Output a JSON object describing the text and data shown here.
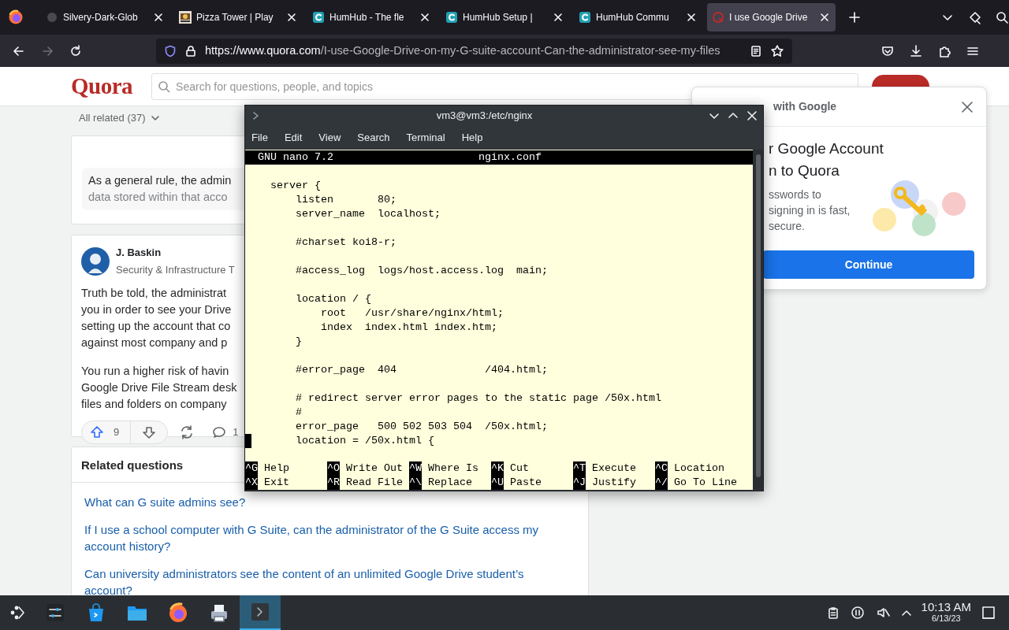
{
  "browser": {
    "tabs": [
      {
        "title": "Silvery-Dark-Glob",
        "kind": "blank",
        "selected": false
      },
      {
        "title": "Pizza Tower | Play",
        "kind": "picture",
        "selected": false
      },
      {
        "title": "HumHub - The fle",
        "kind": "ring",
        "selected": false
      },
      {
        "title": "HumHub Setup |",
        "kind": "ring",
        "selected": false
      },
      {
        "title": "HumHub Commu",
        "kind": "ring",
        "selected": false
      },
      {
        "title": "I use Google Drive",
        "kind": "quora",
        "selected": true
      }
    ],
    "nav": [
      {
        "kind": "back",
        "disabled": false
      },
      {
        "kind": "forward",
        "disabled": true
      },
      {
        "kind": "reload",
        "disabled": false
      }
    ],
    "address": {
      "domain": "https://www.quora.com",
      "path": "/I-use-Google-Drive-on-my-G-suite-account-Can-the-administrator-see-my-files"
    }
  },
  "quora": {
    "logo": "Quora",
    "search": {
      "placeholder": "Search for questions, people, and topics"
    },
    "filter": "All related (37)",
    "summary": [
      "As a general rule, the admin",
      "data stored within that acco"
    ],
    "answer": {
      "author": "J. Baskin",
      "credential": "Security & Infrastructure T",
      "paragraphs": [
        [
          "Truth be told, the administrat",
          "you in order to see your Drive",
          "setting up the account that co",
          "against most company and p"
        ],
        [
          "You run a higher risk of havin",
          "Google Drive File Stream desk",
          "files and folders on company"
        ]
      ],
      "upvotes": "9",
      "comments": "1"
    },
    "related": {
      "title": "Related questions",
      "questions": [
        "What can G suite admins see?",
        "If I use a school computer with G Suite, can the administrator of the G Suite access my account history?",
        "Can university administrators see the content of an unlimited Google Drive student’s account?"
      ]
    }
  },
  "google_prompt": {
    "header": "with Google",
    "title_lines": [
      "r Google Account",
      "n to Quora"
    ],
    "body_lines": [
      "sswords to",
      "signing in is fast,",
      "secure."
    ],
    "button": "Continue"
  },
  "terminal": {
    "title": "vm3@vm3:/etc/nginx",
    "menu": [
      "File",
      "Edit",
      "View",
      "Search",
      "Terminal",
      "Help"
    ],
    "nano": {
      "version": "GNU nano 7.2",
      "filename": "nginx.conf",
      "cursor_on_last_line": true,
      "blocks": [
        [
          "    server {",
          "        listen       80;",
          "        server_name  localhost;"
        ],
        [
          "        #charset koi8-r;"
        ],
        [
          "        #access_log  logs/host.access.log  main;"
        ],
        [
          "        location / {",
          "            root   /usr/share/nginx/html;",
          "            index  index.html index.htm;",
          "        }"
        ],
        [
          "        #error_page  404              /404.html;"
        ],
        [
          "        # redirect server error pages to the static page /50x.html",
          "        #",
          "        error_page   500 502 503 504  /50x.html;",
          "        location = /50x.html {"
        ]
      ],
      "shortcuts": [
        [
          {
            "key": "^G",
            "label": "Help"
          },
          {
            "key": "^O",
            "label": "Write Out"
          },
          {
            "key": "^W",
            "label": "Where Is"
          },
          {
            "key": "^K",
            "label": "Cut"
          },
          {
            "key": "^T",
            "label": "Execute"
          },
          {
            "key": "^C",
            "label": "Location"
          }
        ],
        [
          {
            "key": "^X",
            "label": "Exit"
          },
          {
            "key": "^R",
            "label": "Read File"
          },
          {
            "key": "^\\",
            "label": "Replace"
          },
          {
            "key": "^U",
            "label": "Paste"
          },
          {
            "key": "^J",
            "label": "Justify"
          },
          {
            "key": "^/",
            "label": "Go To Line"
          }
        ]
      ]
    }
  },
  "taskbar": {
    "apps": [
      {
        "kind": "settings",
        "active": false
      },
      {
        "kind": "store",
        "active": false
      },
      {
        "kind": "folder",
        "active": false
      },
      {
        "kind": "browser",
        "active": false
      },
      {
        "kind": "printer",
        "active": false
      },
      {
        "kind": "terminal",
        "active": true
      }
    ],
    "clock": {
      "time": "10:13 AM",
      "date": "6/13/23"
    }
  }
}
